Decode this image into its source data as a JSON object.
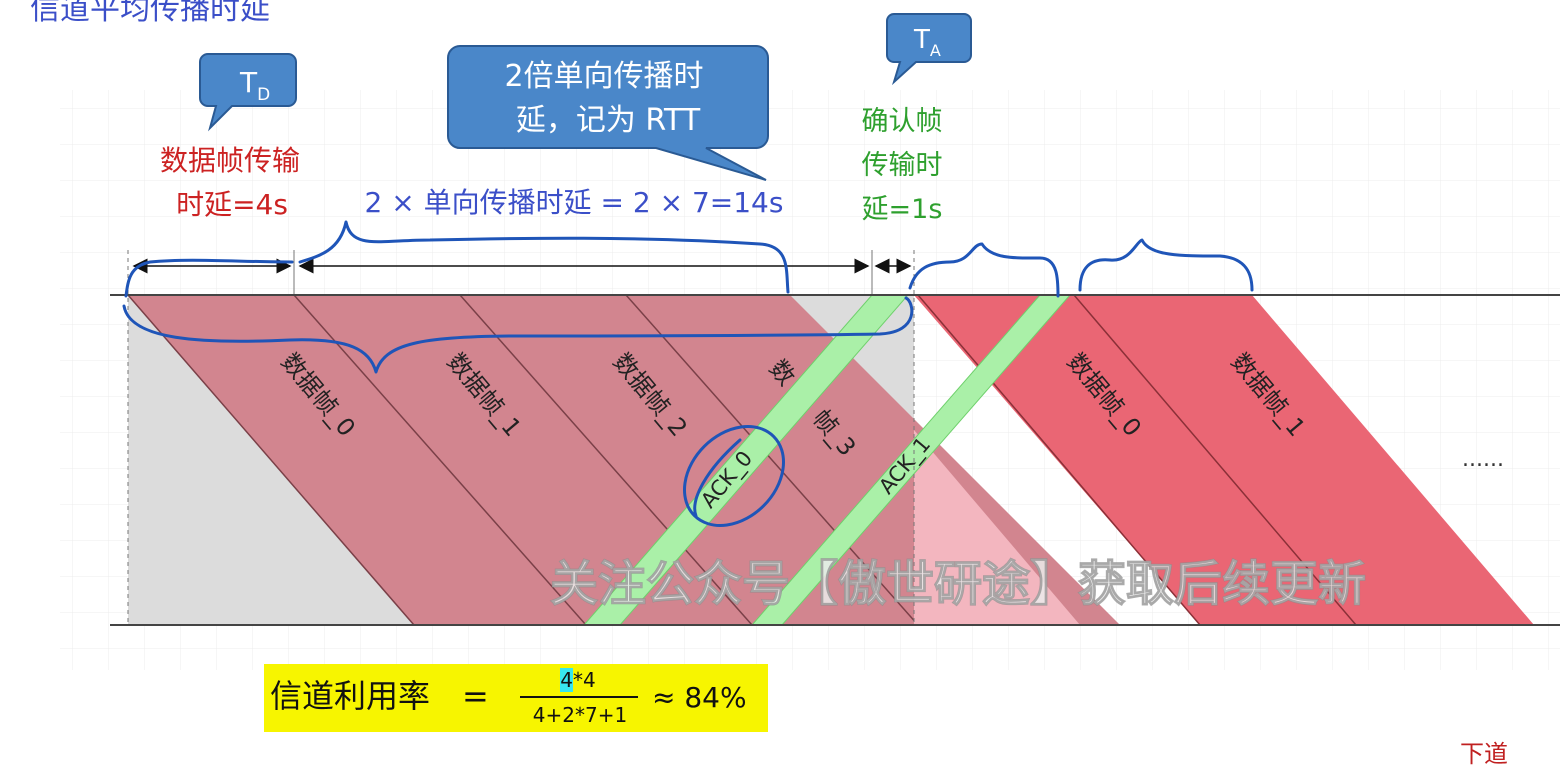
{
  "top_cut_text": "信道平均传播时延",
  "bottom_cut_text": "下道",
  "callouts": {
    "td": {
      "main": "T",
      "sub": "D"
    },
    "rtt": {
      "line1": "2倍单向传播时",
      "line2": "延，记为 RTT"
    },
    "ta": {
      "main": "T",
      "sub": "A"
    }
  },
  "labels": {
    "data_tx_line1": "数据帧传输",
    "data_tx_line2": "时延=4s",
    "rtt_formula": "2 × 单向传播时延 = 2 × 7=14s",
    "ack_tx_line1": "确认帧",
    "ack_tx_line2": "传输时",
    "ack_tx_line3": "延=1s",
    "ellipsis": "......"
  },
  "frames": {
    "f0": "数据帧_0",
    "f1": "数据帧_1",
    "f2": "数据帧_2",
    "f3": "数据帧_3",
    "f3_visible_left": "数",
    "f3_visible_right": "帧_3",
    "next0": "数据帧_0",
    "next1": "数据帧_1",
    "ack0": "ACK_0",
    "ack1": "ACK_1"
  },
  "watermark": "关注公众号【傲世研途】获取后续更新",
  "formula": {
    "label": "信道利用率",
    "eq": "=",
    "numerator": "4*4",
    "numerator_highlight": "4",
    "numerator_rest": "*4",
    "denominator": "4+2*7+1",
    "result": "≈ 84%"
  },
  "colors": {
    "frame_fill": "#d2858f",
    "next_frame_fill": "#ea6674",
    "ack_fill": "#aaf0a8",
    "idle_fill": "#dcdcdc",
    "callout_fill": "#4a87c9",
    "data_label_color": "#cc2222",
    "rtt_label_color": "#3b4fc8",
    "ack_label_color": "#2ea02e",
    "highlight_yellow": "#f7f500",
    "annotation_ink": "#1f55b8"
  }
}
